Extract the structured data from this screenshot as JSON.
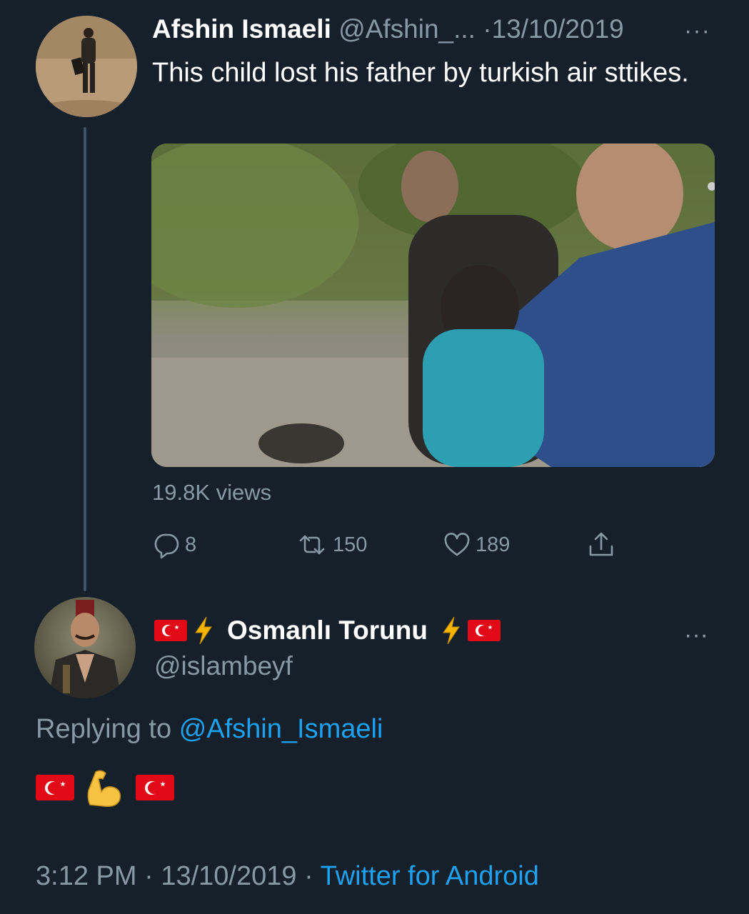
{
  "tweet": {
    "author_name": "Afshin Ismaeli",
    "author_handle": "@Afshin_...",
    "separator": "·",
    "date": "13/10/2019",
    "more_label": "···",
    "text": "This child lost his father by turkish air sttikes.",
    "views": "19.8K views",
    "actions": {
      "replies": "8",
      "retweets": "150",
      "likes": "189"
    }
  },
  "reply": {
    "author_name": "Osmanlı Torunu",
    "author_handle": "@islambeyf",
    "more_label": "···",
    "replying_prefix": "Replying to",
    "replying_to": "@Afshin_Ismaeli",
    "timestamp_time": "3:12 PM",
    "separator": "·",
    "timestamp_date": "13/10/2019",
    "source": "Twitter for Android"
  },
  "colors": {
    "background": "#15202b",
    "secondary_text": "#8899a6",
    "link": "#1da1f2",
    "thread_line": "#3d5466"
  },
  "icons": [
    "reply-icon",
    "retweet-icon",
    "like-icon",
    "share-icon",
    "more-icon",
    "turkish-flag-icon",
    "lightning-icon",
    "flexed-biceps-icon"
  ]
}
